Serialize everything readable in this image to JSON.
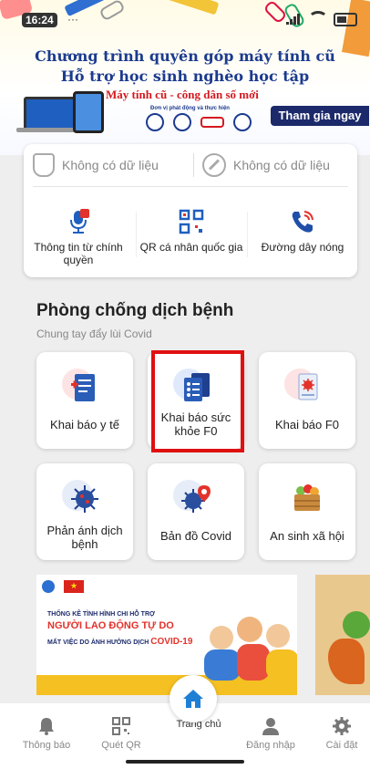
{
  "status_bar": {
    "time": "16:24",
    "dots": "···"
  },
  "banner": {
    "title_line1": "Chương trình quyên góp máy tính cũ",
    "title_line2": "Hỗ trợ học sinh nghèo học tập",
    "subtitle": "Máy tính cũ - công dân số mới",
    "org_label": "Đơn vị phát động và thực hiện",
    "join_label": "Tham gia ngay"
  },
  "info": {
    "left_text": "Không có dữ liệu",
    "right_text": "Không có dữ liệu"
  },
  "quick_actions": [
    {
      "label": "Thông tin từ chính quyền",
      "icon": "microphone-icon"
    },
    {
      "label": "QR cá nhân quốc gia",
      "icon": "qr-code-icon"
    },
    {
      "label": "Đường dây nóng",
      "icon": "phone-icon"
    }
  ],
  "section": {
    "title": "Phòng chống dịch bệnh",
    "subtitle": "Chung tay đẩy lùi Covid"
  },
  "tiles": [
    {
      "label": "Khai báo y tế",
      "icon": "medical-document-icon"
    },
    {
      "label": "Khai báo sức khỏe F0",
      "icon": "health-forms-icon"
    },
    {
      "label": "Khai báo F0",
      "icon": "virus-report-icon"
    },
    {
      "label": "Phản ánh dịch bệnh",
      "icon": "virus-icon"
    },
    {
      "label": "Bản đồ Covid",
      "icon": "covid-map-icon"
    },
    {
      "label": "An sinh xã hội",
      "icon": "food-basket-icon"
    }
  ],
  "promo": {
    "line1": "THỐNG KÊ TÌNH HÌNH CHI HỖ TRỢ",
    "line2": "NGƯỜI LAO ĐỘNG TỰ DO",
    "line3": "MẤT VIỆC DO ẢNH HƯỞNG DỊCH",
    "covid": "COVID-19"
  },
  "bottom_nav": {
    "notifications": "Thông báo",
    "scan_qr": "Quét QR",
    "home": "Trang chủ",
    "login": "Đăng nhập",
    "settings": "Cài đặt"
  },
  "colors": {
    "brand_blue": "#1c3b8f",
    "accent_red": "#d4191f",
    "highlight": "#e01010",
    "nav_blue": "#1f7fd4"
  }
}
